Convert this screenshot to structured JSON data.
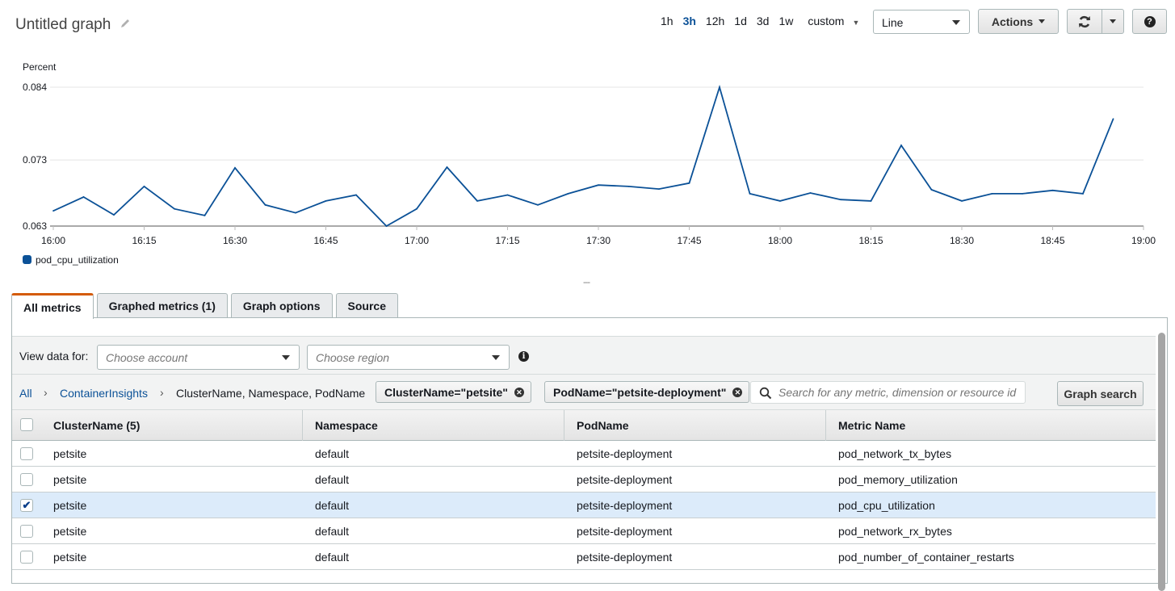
{
  "header": {
    "title": "Untitled graph",
    "time_ranges": [
      "1h",
      "3h",
      "12h",
      "1d",
      "3d",
      "1w"
    ],
    "active_range": "3h",
    "custom_label": "custom",
    "chart_type_value": "Line",
    "actions_label": "Actions",
    "help_glyph": "?"
  },
  "colors": {
    "series": "#0b5197",
    "tab_accent": "#d45b07",
    "link": "#0b5197",
    "selected_row": "#dcebfa"
  },
  "chart_data": {
    "type": "line",
    "title": "",
    "ylabel": "Percent",
    "xlabel": "",
    "ylim": [
      0.063,
      0.084
    ],
    "yticks": [
      "0.084",
      "0.073",
      "0.063"
    ],
    "ytick_values": [
      0.084,
      0.073,
      0.063
    ],
    "xticks": [
      "16:00",
      "16:15",
      "16:30",
      "16:45",
      "17:00",
      "17:15",
      "17:30",
      "17:45",
      "18:00",
      "18:15",
      "18:30",
      "18:45",
      "19:00"
    ],
    "xlim_minutes": [
      0,
      180
    ],
    "grid": true,
    "legend_position": "bottom-left",
    "series": [
      {
        "name": "pod_cpu_utilization",
        "x_minutes": [
          0,
          5,
          10,
          15,
          20,
          25,
          30,
          35,
          40,
          45,
          50,
          55,
          60,
          65,
          70,
          75,
          80,
          85,
          90,
          95,
          100,
          105,
          110,
          115,
          120,
          125,
          130,
          135,
          140,
          145,
          150,
          155,
          160,
          165,
          170,
          175
        ],
        "values": [
          0.0653,
          0.0674,
          0.0647,
          0.069,
          0.0656,
          0.0646,
          0.0718,
          0.0662,
          0.065,
          0.0668,
          0.0677,
          0.063,
          0.0656,
          0.0719,
          0.0668,
          0.0677,
          0.0662,
          0.0679,
          0.0692,
          0.069,
          0.0686,
          0.0695,
          0.084,
          0.0679,
          0.0668,
          0.068,
          0.067,
          0.0668,
          0.0752,
          0.0685,
          0.0668,
          0.0679,
          0.0679,
          0.0684,
          0.0679,
          0.0792
        ]
      }
    ]
  },
  "resize_handle": "---",
  "tabs": [
    {
      "label": "All metrics",
      "active": true
    },
    {
      "label": "Graphed metrics (1)",
      "active": false
    },
    {
      "label": "Graph options",
      "active": false
    },
    {
      "label": "Source",
      "active": false
    }
  ],
  "filters": {
    "view_data_label": "View data for:",
    "account_placeholder": "Choose account",
    "region_placeholder": "Choose region"
  },
  "breadcrumb": {
    "items": [
      "All",
      "ContainerInsights",
      "ClusterName, Namespace, PodName"
    ],
    "separator": "›",
    "pills": [
      "ClusterName=\"petsite\"",
      "PodName=\"petsite-deployment\""
    ],
    "search_placeholder": "Search for any metric, dimension or resource id",
    "graph_search_label": "Graph search"
  },
  "table": {
    "columns": [
      "ClusterName (5)",
      "Namespace",
      "PodName",
      "Metric Name"
    ],
    "rows": [
      {
        "checked": false,
        "cells": [
          "petsite",
          "default",
          "petsite-deployment",
          "pod_network_tx_bytes"
        ]
      },
      {
        "checked": false,
        "cells": [
          "petsite",
          "default",
          "petsite-deployment",
          "pod_memory_utilization"
        ]
      },
      {
        "checked": true,
        "cells": [
          "petsite",
          "default",
          "petsite-deployment",
          "pod_cpu_utilization"
        ]
      },
      {
        "checked": false,
        "cells": [
          "petsite",
          "default",
          "petsite-deployment",
          "pod_network_rx_bytes"
        ]
      },
      {
        "checked": false,
        "cells": [
          "petsite",
          "default",
          "petsite-deployment",
          "pod_number_of_container_restarts"
        ]
      }
    ]
  }
}
